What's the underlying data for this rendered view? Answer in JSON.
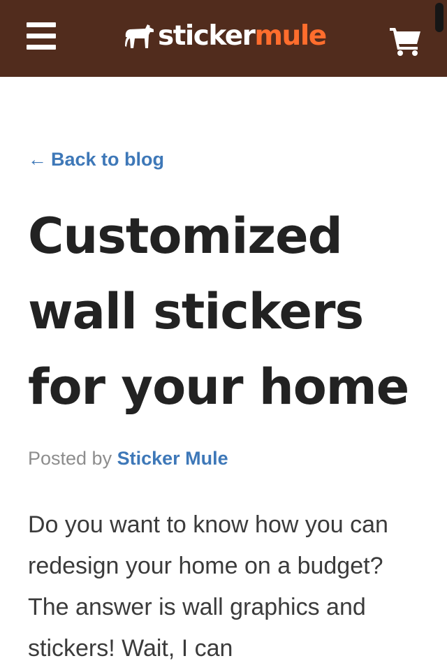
{
  "header": {
    "menu_icon": "hamburger-menu-icon",
    "logo": {
      "icon": "mule-icon",
      "text_primary": "sticker",
      "text_accent": "mule",
      "color_primary": "#ffffff",
      "color_accent": "#ff6d2d"
    },
    "cart_icon": "shopping-cart-icon",
    "background_color": "#512c1d"
  },
  "back_link": {
    "arrow": "←",
    "label": "Back to blog"
  },
  "post": {
    "title": "Customized wall stickers for your home",
    "byline_prefix": "Posted by",
    "author": "Sticker Mule",
    "body": "Do you want to know how you can redesign your home on a budget? The answer is wall graphics and stickers! Wait, I can"
  },
  "colors": {
    "link": "#3e78b8",
    "title": "#222222",
    "body": "#3b3b3b",
    "muted": "#8d8d8d"
  }
}
